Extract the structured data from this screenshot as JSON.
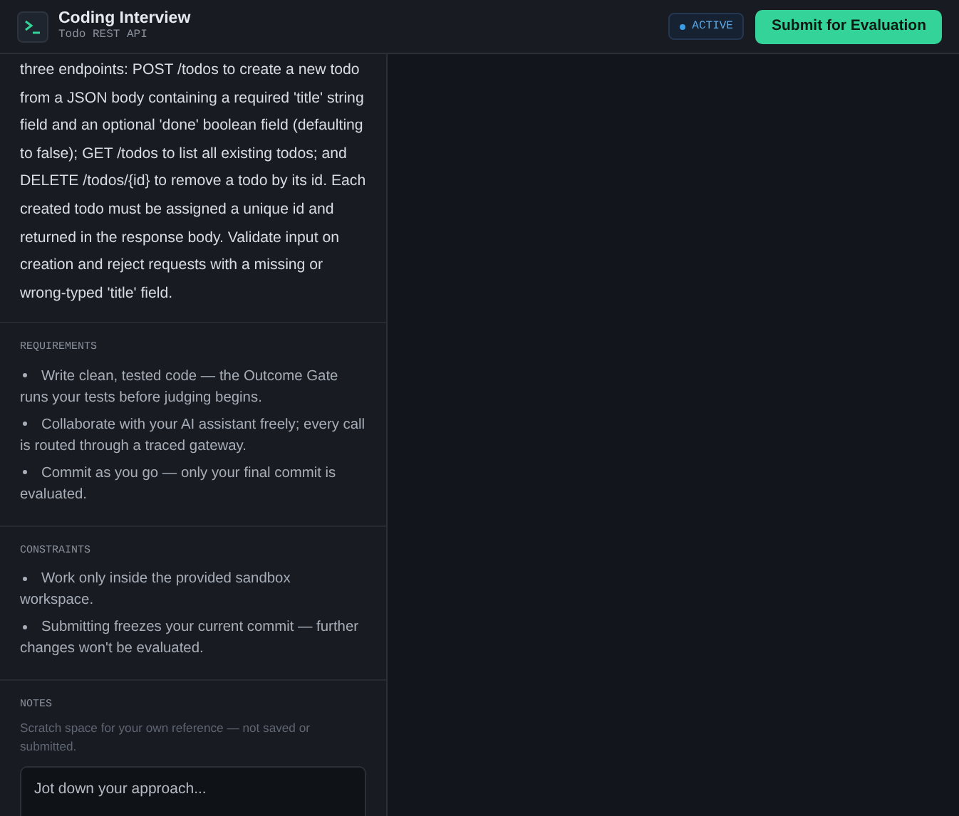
{
  "header": {
    "title": "Coding Interview",
    "subtitle": "Todo REST API",
    "status": {
      "label": "ACTIVE",
      "color": "#3b9ee8"
    },
    "submit_button": "Submit for Evaluation"
  },
  "description": "three endpoints: POST /todos to create a new todo from a JSON body containing a required 'title' string field and an optional 'done' boolean field (defaulting to false); GET /todos to list all existing todos; and DELETE /todos/{id} to remove a todo by its id. Each created todo must be assigned a unique id and returned in the response body. Validate input on creation and reject requests with a missing or wrong-typed 'title' field.",
  "sections": [
    {
      "heading": "REQUIREMENTS",
      "items": [
        "Write clean, tested code — the Outcome Gate runs your tests before judging begins.",
        "Collaborate with your AI assistant freely; every call is routed through a traced gateway.",
        "Commit as you go — only your final commit is evaluated."
      ]
    },
    {
      "heading": "CONSTRAINTS",
      "items": [
        "Work only inside the provided sandbox workspace.",
        "Submitting freezes your current commit — further changes won't be evaluated."
      ]
    }
  ],
  "notes": {
    "heading": "NOTES",
    "hint": "Scratch space for your own reference — not saved or submitted.",
    "placeholder": "Jot down your approach..."
  }
}
